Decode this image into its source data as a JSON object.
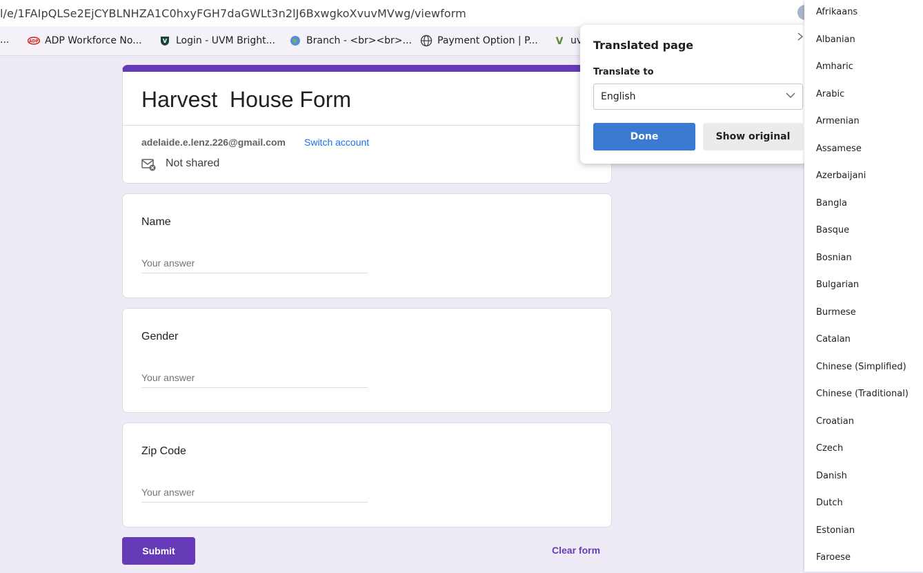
{
  "browser": {
    "url": "l/e/1FAIpQLSe2EjCYBLNHZA1C0hxyFGH7daGWLt3n2lJ6BxwgkoXvuvMVwg/viewform",
    "bookmarks": [
      {
        "label": "...",
        "icon": "ellipsis"
      },
      {
        "label": "ADP Workforce No...",
        "icon": "adp-icon"
      },
      {
        "label": "Login - UVM Bright...",
        "icon": "uvm-icon"
      },
      {
        "label": "Branch - <br><br>...",
        "icon": "globe-icon"
      },
      {
        "label": "Payment Option | P...",
        "icon": "web-icon"
      },
      {
        "label": "uv",
        "icon": "uvm-icon"
      }
    ]
  },
  "form": {
    "title": "Harvest  House Form",
    "email": "adelaide.e.lenz.226@gmail.com",
    "switch_account": "Switch account",
    "not_shared": "Not shared",
    "questions": [
      {
        "label": "Name",
        "placeholder": "Your answer"
      },
      {
        "label": "Gender",
        "placeholder": "Your answer"
      },
      {
        "label": "Zip Code",
        "placeholder": "Your answer"
      }
    ],
    "submit": "Submit",
    "clear": "Clear form",
    "accent": "#673ab7"
  },
  "translate_popup": {
    "title": "Translated page",
    "translate_to_label": "Translate to",
    "selected_language": "English",
    "done": "Done",
    "show_original": "Show original"
  },
  "language_list": [
    "Afrikaans",
    "Albanian",
    "Amharic",
    "Arabic",
    "Armenian",
    "Assamese",
    "Azerbaijani",
    "Bangla",
    "Basque",
    "Bosnian",
    "Bulgarian",
    "Burmese",
    "Catalan",
    "Chinese (Simplified)",
    "Chinese (Traditional)",
    "Croatian",
    "Czech",
    "Danish",
    "Dutch",
    "Estonian",
    "Faroese"
  ]
}
